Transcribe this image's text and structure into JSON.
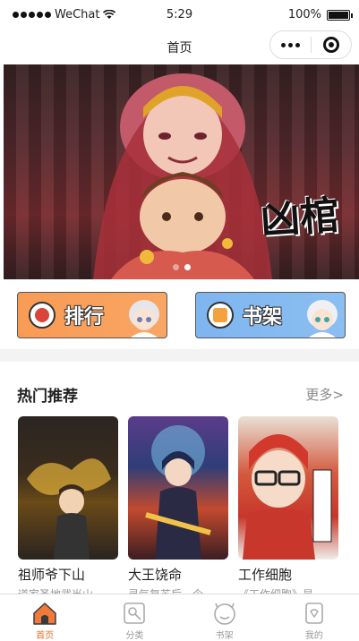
{
  "status_bar": {
    "carrier": "WeChat",
    "time": "5:29",
    "battery": "100%",
    "battery_level": 1.0
  },
  "nav": {
    "title": "首页"
  },
  "banner": {
    "logo_text": "凶棺",
    "slide_count": 2,
    "active_slide": 1
  },
  "quick_entries": [
    {
      "label": "排行",
      "color": "#f89b55"
    },
    {
      "label": "书架",
      "color": "#7fb5ef"
    }
  ],
  "section": {
    "title": "热门推荐",
    "more": "更多>"
  },
  "cards": [
    {
      "title": "祖师爷下山",
      "desc": "道家圣地武当山"
    },
    {
      "title": "大王饶命",
      "desc": "灵气复苏后，今"
    },
    {
      "title": "工作细胞",
      "desc": "《工作细胞》是"
    }
  ],
  "tabs": [
    {
      "label": "首页",
      "active": true,
      "icon": "home-icon"
    },
    {
      "label": "分类",
      "active": false,
      "icon": "category-icon"
    },
    {
      "label": "书架",
      "active": false,
      "icon": "bookshelf-icon"
    },
    {
      "label": "我的",
      "active": false,
      "icon": "profile-icon"
    }
  ],
  "colors": {
    "accent": "#e0702b",
    "tab_inactive": "#999999"
  }
}
